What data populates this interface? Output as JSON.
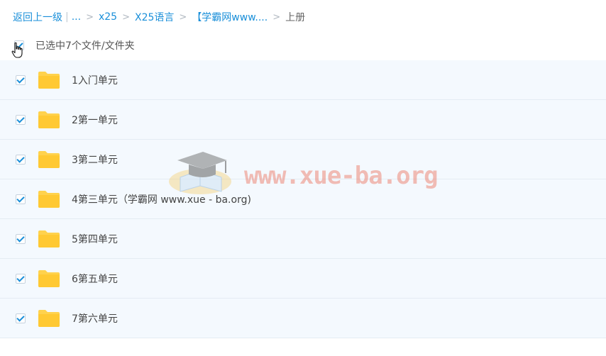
{
  "breadcrumb": {
    "back": "返回上一级",
    "separator": "|",
    "ellipsis": "...",
    "items": [
      "x25",
      "X25语言",
      "【学霸网www...."
    ],
    "current": "上册"
  },
  "selection": {
    "label": "已选中7个文件/文件夹"
  },
  "files": [
    {
      "name": "1入门单元"
    },
    {
      "name": "2第一单元"
    },
    {
      "name": "3第二单元"
    },
    {
      "name": "4第三单元（学霸网 www.xue - ba.org)"
    },
    {
      "name": "5第四单元"
    },
    {
      "name": "6第五单元"
    },
    {
      "name": "7第六单元"
    }
  ],
  "watermark": {
    "text": "www.xue-ba.org",
    "icon": "graduation-cap-book-icon"
  },
  "colors": {
    "link": "#1a8fd9",
    "row_bg": "#f4f9fe",
    "folder": "#ffd24d",
    "watermark": "#eb6e5a"
  }
}
